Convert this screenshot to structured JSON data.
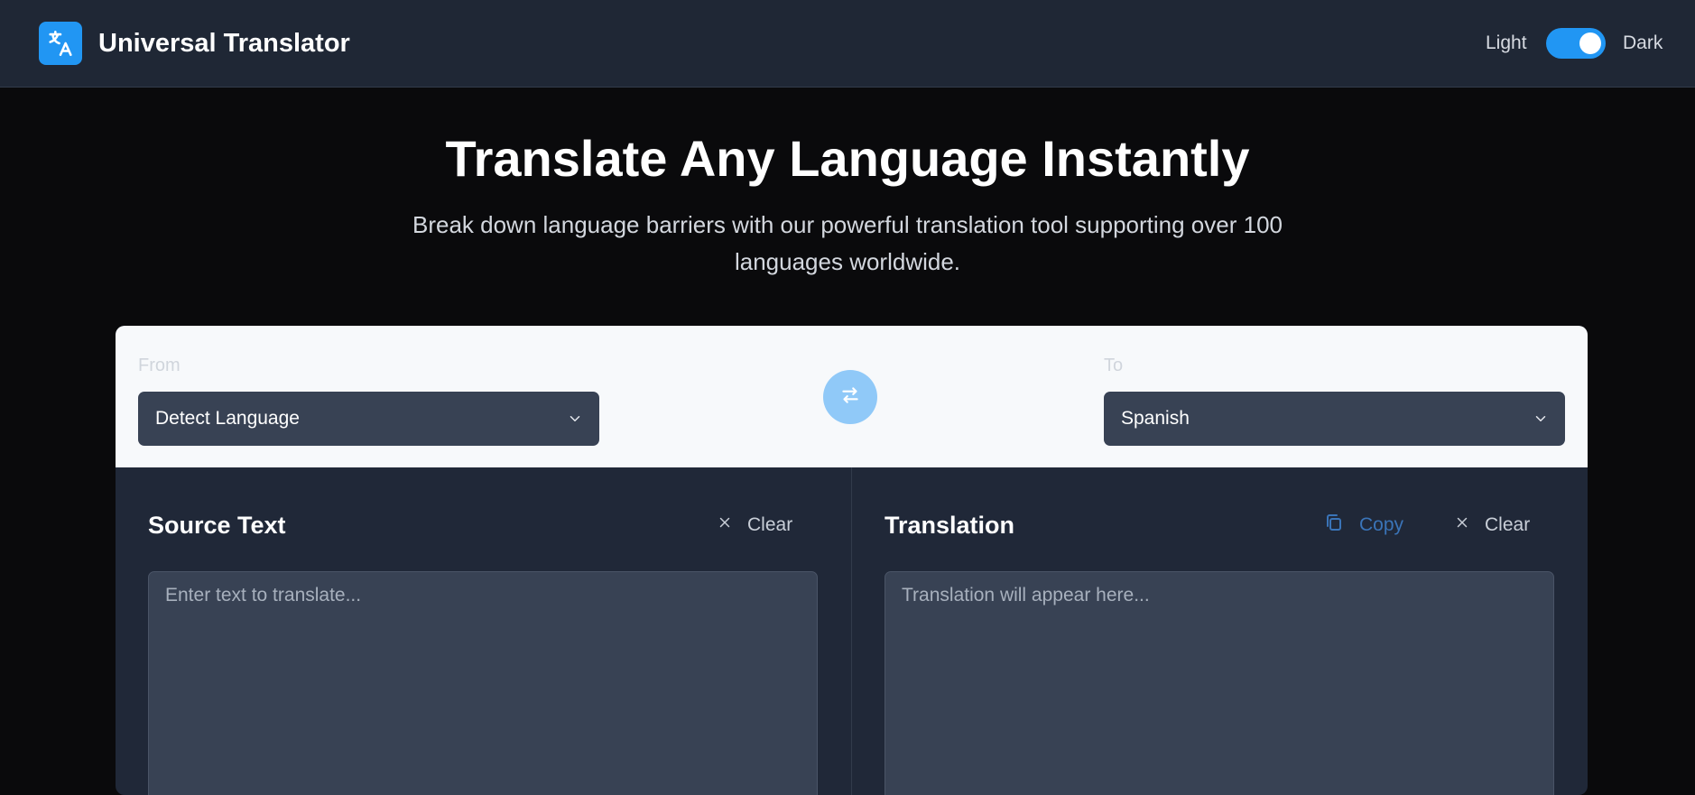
{
  "header": {
    "app_title": "Universal Translator",
    "theme_light_label": "Light",
    "theme_dark_label": "Dark",
    "theme_mode": "dark"
  },
  "hero": {
    "title": "Translate Any Language Instantly",
    "subtitle": "Break down language barriers with our powerful translation tool supporting over 100 languages worldwide."
  },
  "language_bar": {
    "from_label": "From",
    "from_selected": "Detect Language",
    "to_label": "To",
    "to_selected": "Spanish"
  },
  "source_panel": {
    "title": "Source Text",
    "clear_label": "Clear",
    "placeholder": "Enter text to translate...",
    "value": ""
  },
  "translation_panel": {
    "title": "Translation",
    "copy_label": "Copy",
    "clear_label": "Clear",
    "placeholder": "Translation will appear here...",
    "value": ""
  },
  "icons": {
    "logo": "translate-icon",
    "chevron": "chevron-down-icon",
    "swap": "swap-icon",
    "clear": "close-icon",
    "copy": "copy-icon"
  },
  "colors": {
    "accent": "#2196f3",
    "header_bg": "#1f2735",
    "page_bg": "#0a0a0c",
    "panel_bg": "#202838",
    "field_bg": "#384254",
    "swap_bg": "#90c9f8",
    "copy_text": "#3a74b8"
  }
}
